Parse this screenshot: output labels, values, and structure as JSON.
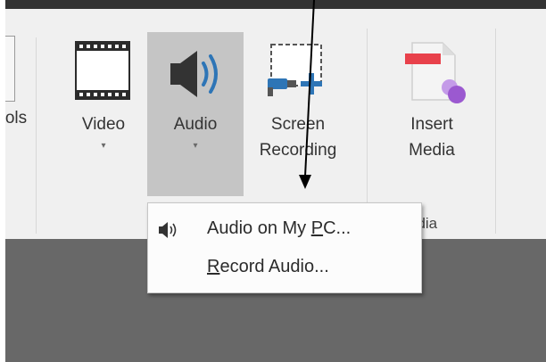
{
  "ribbon": {
    "partial_label_left": "ols",
    "video": {
      "label": "Video",
      "caret": "▾",
      "icon": "film-strip-icon"
    },
    "audio": {
      "label": "Audio",
      "caret": "▾",
      "icon": "speaker-icon"
    },
    "screen_recording": {
      "label_line1": "Screen",
      "label_line2": "Recording",
      "icon": "screen-recording-icon"
    },
    "insert_media": {
      "label_line1": "Insert",
      "label_line2": "Media",
      "icon": "insert-media-icon"
    },
    "group_label_partial": "edia"
  },
  "audio_menu": {
    "items": [
      {
        "pre": "Audio on My ",
        "accel": "P",
        "post": "C...",
        "icon": "speaker-icon"
      },
      {
        "pre": "",
        "accel": "R",
        "post": "ecord Audio...",
        "icon": ""
      }
    ]
  },
  "annotation": {
    "shape": "arrow",
    "color": "#000000"
  },
  "colors": {
    "ribbon_bg": "#f0f0f0",
    "pressed_button": "#c5c5c5",
    "below_ribbon": "#686868",
    "accent_blue": "#2e75b6",
    "media_red": "#e8414b",
    "media_purple": "#9b59d0"
  }
}
